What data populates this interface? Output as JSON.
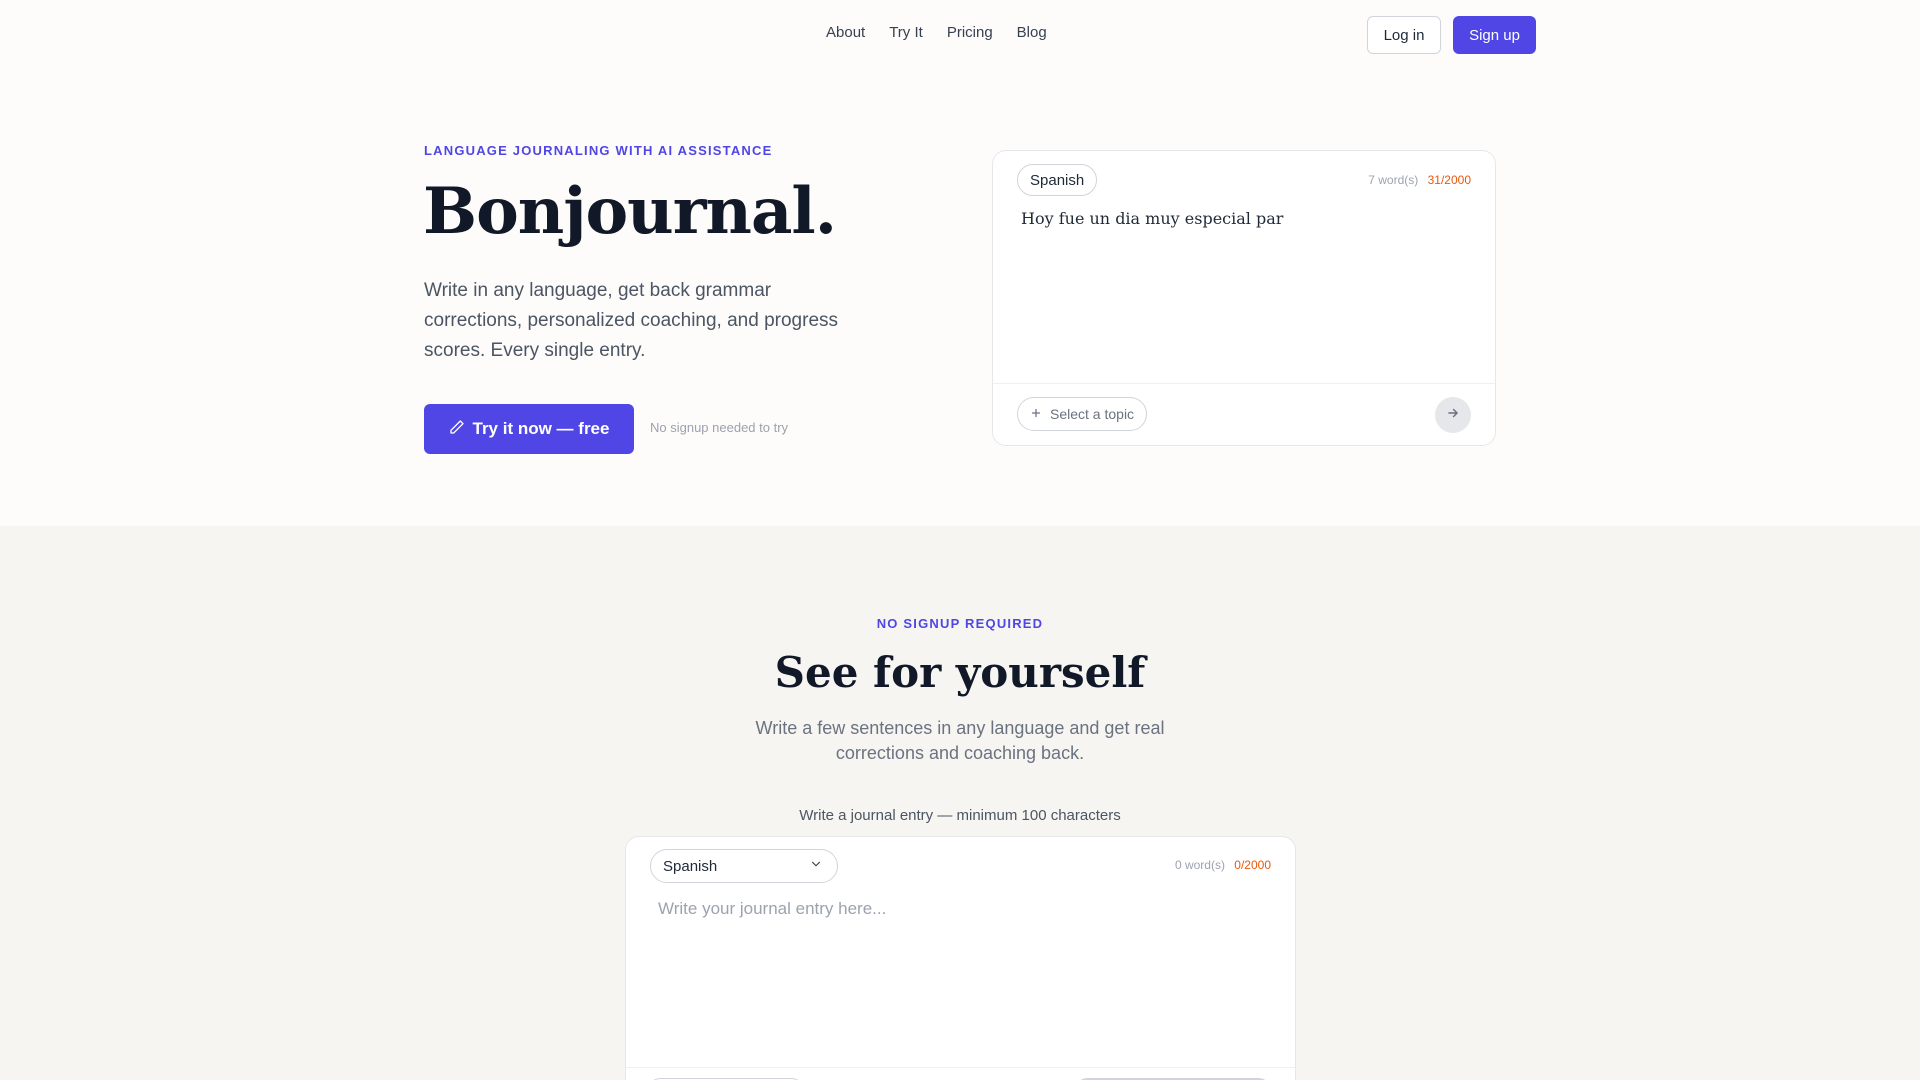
{
  "nav": {
    "links": [
      "About",
      "Try It",
      "Pricing",
      "Blog"
    ],
    "login_label": "Log in",
    "signup_label": "Sign up"
  },
  "hero": {
    "eyebrow": "LANGUAGE JOURNALING WITH AI ASSISTANCE",
    "title": "Bonjournal.",
    "description": "Write in any language, get back grammar corrections, personalized coaching, and progress scores. Every single entry.",
    "cta_label": "Try it now — free",
    "cta_icon": "pencil-icon",
    "cta_note": "No signup needed to try"
  },
  "demo": {
    "language": "Spanish",
    "word_count": "7 word(s)",
    "char_count": "31/2000",
    "text": "Hoy fue un dia muy especial par",
    "topic_label": "Select a topic",
    "topic_icon": "plus-icon",
    "send_icon": "arrow-right-icon"
  },
  "try_section": {
    "eyebrow": "NO SIGNUP REQUIRED",
    "title": "See for yourself",
    "description": "Write a few sentences in any language and get real corrections and coaching back.",
    "hint": "Write a journal entry — minimum 100 characters",
    "language_selected": "Spanish",
    "word_count": "0 word(s)",
    "char_count": "0/2000",
    "placeholder": "Write your journal entry here..."
  },
  "colors": {
    "accent": "#4f46e5",
    "counter_accent": "#ea580c",
    "hero_bg": "#fdfcfa",
    "section_bg": "#f6f5f2"
  }
}
